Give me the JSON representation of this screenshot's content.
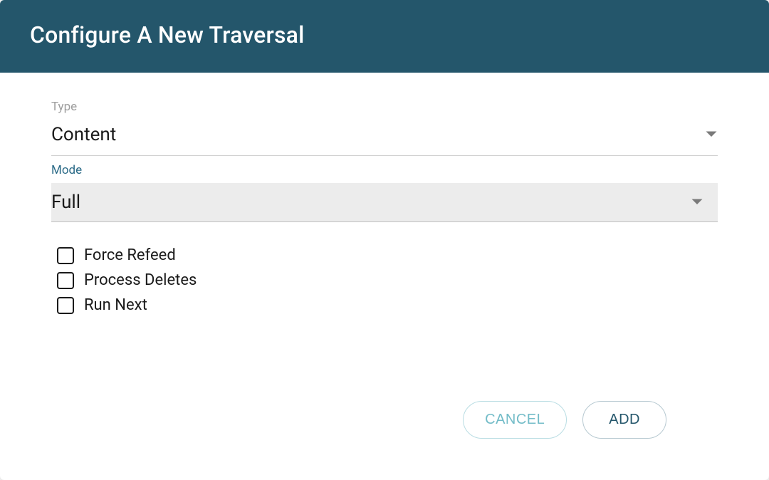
{
  "header": {
    "title": "Configure A New Traversal"
  },
  "fields": {
    "type": {
      "label": "Type",
      "value": "Content"
    },
    "mode": {
      "label": "Mode",
      "value": "Full"
    }
  },
  "checkboxes": {
    "forceRefeed": {
      "label": "Force Refeed"
    },
    "processDeletes": {
      "label": "Process Deletes"
    },
    "runNext": {
      "label": "Run Next"
    }
  },
  "buttons": {
    "cancel": "CANCEL",
    "add": "ADD"
  }
}
